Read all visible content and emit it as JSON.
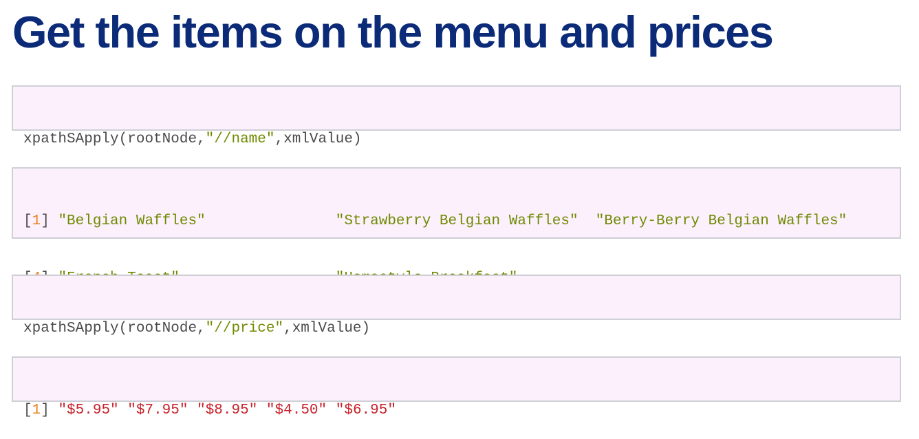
{
  "title": "Get the items on the menu and prices",
  "code_names": {
    "fn": "xpathSApply",
    "open_paren": "(",
    "arg1": "rootNode",
    "comma1": ",",
    "query": "\"//name\"",
    "comma2": ",",
    "arg3": "xmlValue",
    "close_paren": ")"
  },
  "output_names": {
    "rows": [
      {
        "index_open": "[",
        "index": "1",
        "index_close": "]",
        "items": [
          "\"Belgian Waffles\"",
          "\"Strawberry Belgian Waffles\"",
          "\"Berry-Berry Belgian Waffles\""
        ]
      },
      {
        "index_open": "[",
        "index": "4",
        "index_close": "]",
        "items": [
          "\"French Toast\"",
          "\"Homestyle Breakfast\""
        ]
      }
    ]
  },
  "code_prices": {
    "fn": "xpathSApply",
    "open_paren": "(",
    "arg1": "rootNode",
    "comma1": ",",
    "query": "\"//price\"",
    "comma2": ",",
    "arg3": "xmlValue",
    "close_paren": ")"
  },
  "output_prices": {
    "index_open": "[",
    "index": "1",
    "index_close": "]",
    "items": [
      "\"$5.95\"",
      "\"$7.95\"",
      "\"$8.95\"",
      "\"$4.50\"",
      "\"$6.95\""
    ]
  },
  "colors": {
    "title": "#0b2a78",
    "code_background": "#fcf0fd",
    "code_border": "#cfcfd6",
    "code_text": "#4a4a4a",
    "string": "#6f8a00",
    "price_string": "#c8212a",
    "index_number": "#e8821f"
  }
}
